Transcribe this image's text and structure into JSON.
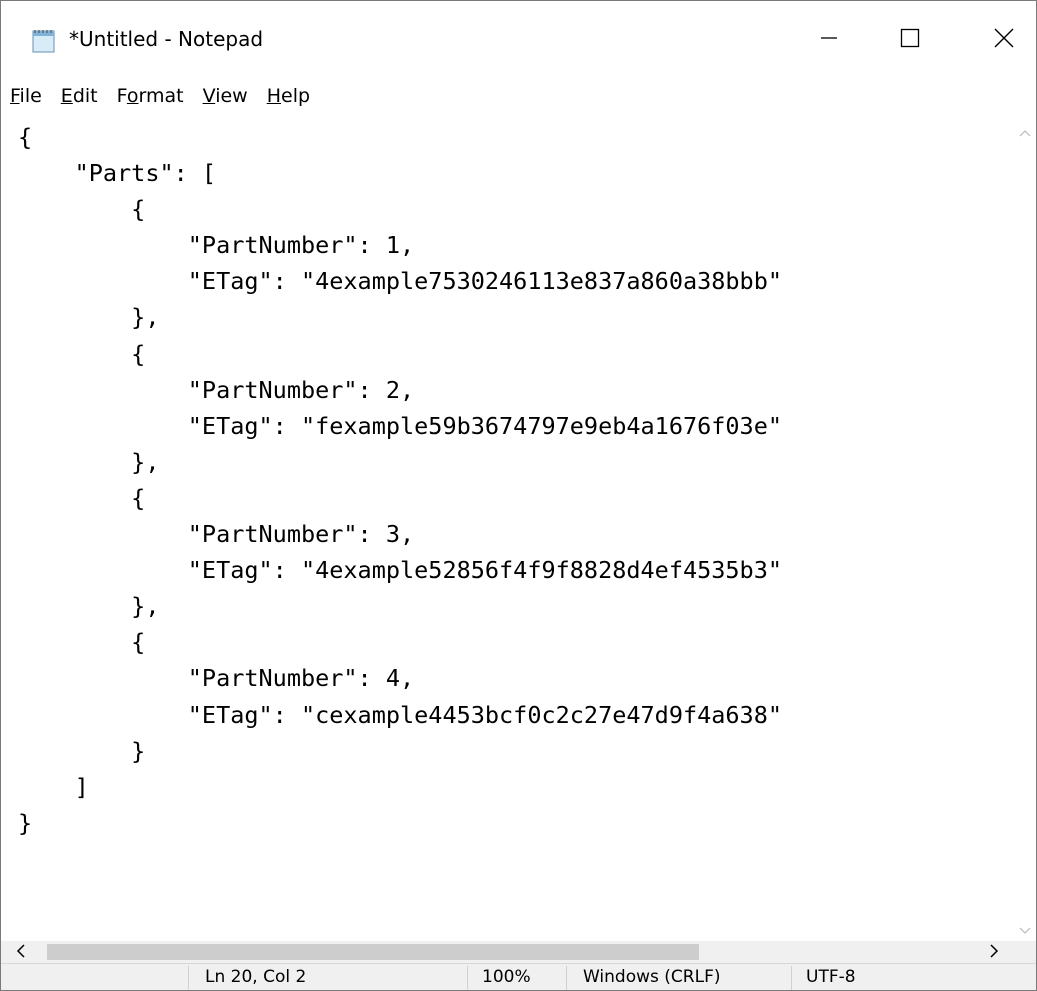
{
  "window": {
    "title": "*Untitled - Notepad"
  },
  "menu": {
    "items": [
      {
        "first": "F",
        "rest": "ile"
      },
      {
        "first": "E",
        "rest": "dit"
      },
      {
        "pre": "F",
        "mid": "o",
        "rest": "rmat"
      },
      {
        "first": "V",
        "rest": "iew"
      },
      {
        "first": "H",
        "rest": "elp"
      }
    ]
  },
  "editor": {
    "lines": [
      "{",
      "    \"Parts\": [",
      "        {",
      "            \"PartNumber\": 1,",
      "            \"ETag\": \"4example7530246113e837a860a38bbb\"",
      "        },",
      "        {",
      "            \"PartNumber\": 2,",
      "            \"ETag\": \"fexample59b3674797e9eb4a1676f03e\"",
      "        },",
      "        {",
      "            \"PartNumber\": 3,",
      "            \"ETag\": \"4example52856f4f9f8828d4ef4535b3\"",
      "        },",
      "        {",
      "            \"PartNumber\": 4,",
      "            \"ETag\": \"cexample4453bcf0c2c27e47d9f4a638\"",
      "        }",
      "    ]",
      "}"
    ]
  },
  "statusbar": {
    "position": "Ln 20, Col 2",
    "zoom": "100%",
    "line_ending": "Windows (CRLF)",
    "encoding": "UTF-8"
  },
  "icons": {
    "app": "notepad-icon",
    "minimize": "minimize-icon",
    "maximize": "maximize-icon",
    "close": "close-icon",
    "scroll_left": "chevron-left-icon",
    "scroll_right": "chevron-right-icon",
    "scroll_up": "chevron-up-icon",
    "scroll_down": "chevron-down-icon"
  }
}
